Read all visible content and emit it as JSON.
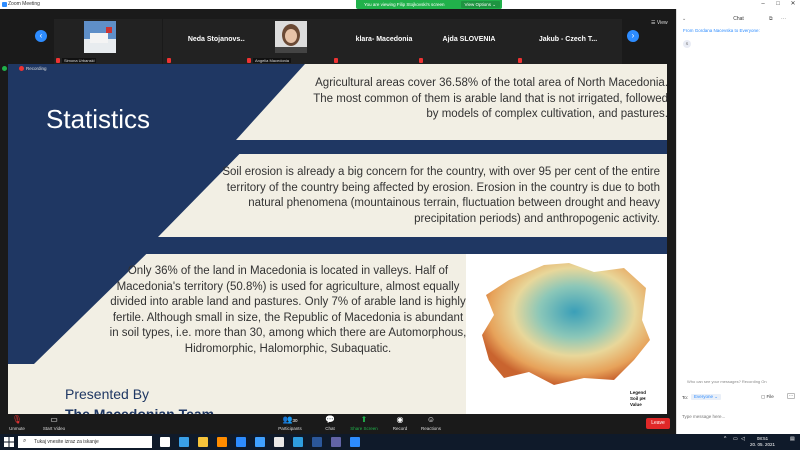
{
  "window": {
    "title": "Zoom Meeting",
    "controls": [
      "–",
      "□",
      "✕"
    ]
  },
  "share_banner": {
    "message": "You are viewing Filip Stojkovski's screen",
    "options_label": "View Options ⌄"
  },
  "gallery": {
    "view_label": "☰ View",
    "tiles": [
      {
        "name": "",
        "label": "Simona Urbanski",
        "has_photo": true
      },
      {
        "name": "Neda Stojanovs...",
        "label": ""
      },
      {
        "name": "",
        "label": "Angelia Macedonia",
        "has_photo": true
      },
      {
        "name": "klara- Macedonia",
        "label": ""
      },
      {
        "name": "Ajda SLOVENIA",
        "label": ""
      },
      {
        "name": "Jakub - Czech T...",
        "label": ""
      }
    ]
  },
  "recording_label": "Recording",
  "slide": {
    "title": "Statistics",
    "para1": "Agricultural areas cover 36.58% of the total area of North Macedonia. The most common of them is arable land that is not irrigated, followed by models of complex cultivation, and pastures.",
    "para2": "Soil erosion is already a big concern for the country, with over 95 per cent of the entire territory of the country being affected by erosion. Erosion in the country is due to both natural phenomena (mountainous terrain, fluctuation between drought and heavy precipitation periods) and anthropogenic activity.",
    "para3": "Only 36% of the land in Macedonia is located in valleys. Half of Macedonia's territory (50.8%) is used for agriculture, almost equally divided into arable land and pastures. Only 7% of arable land is highly fertile. Although small in size, the Republic of Macedonia is abundant in soil types, i.e. more than 30, among which there are Automorphous, Hidromorphic, Halomorphic, Subaquatic.",
    "legend_title": "Legend",
    "legend_sub": "Soil pH",
    "legend_value": "Value",
    "presented_by": "Presented By",
    "presented_name": "The Macedonian Team"
  },
  "chat": {
    "title": "Chat",
    "from_line": "From Gordana Nacevska to Everyone:",
    "avatar": "S",
    "who_can_see": "Who can see your messages? Recording On",
    "to_label": "To:",
    "to_value": "Everyone ⌄",
    "file_label": "File",
    "more_label": "···",
    "input_placeholder": "Type message here..."
  },
  "toolbar": {
    "unmute": "Unmute",
    "start_video": "Start Video",
    "participants": "Participants",
    "participants_count": "30",
    "chat": "Chat",
    "share_screen": "Share Screen",
    "record": "Record",
    "reactions": "Reactions",
    "leave": "Leave"
  },
  "taskbar": {
    "search_placeholder": "Tukaj vnesite izraz za iskanje",
    "time": "08:51",
    "date": "20. 05. 2021",
    "apps": [
      {
        "name": "task-view",
        "color": "#ffffff"
      },
      {
        "name": "edge",
        "color": "#3aa0e8"
      },
      {
        "name": "file-explorer",
        "color": "#f5c33b"
      },
      {
        "name": "vlc",
        "color": "#ff8c00"
      },
      {
        "name": "mail",
        "color": "#2d8cff"
      },
      {
        "name": "photos",
        "color": "#40a0ff"
      },
      {
        "name": "chrome",
        "color": "#e8e8e8"
      },
      {
        "name": "edge-alt",
        "color": "#2f9ee0"
      },
      {
        "name": "word",
        "color": "#2b579a"
      },
      {
        "name": "teams",
        "color": "#6264a7"
      },
      {
        "name": "zoom",
        "color": "#2d8cff"
      }
    ]
  }
}
